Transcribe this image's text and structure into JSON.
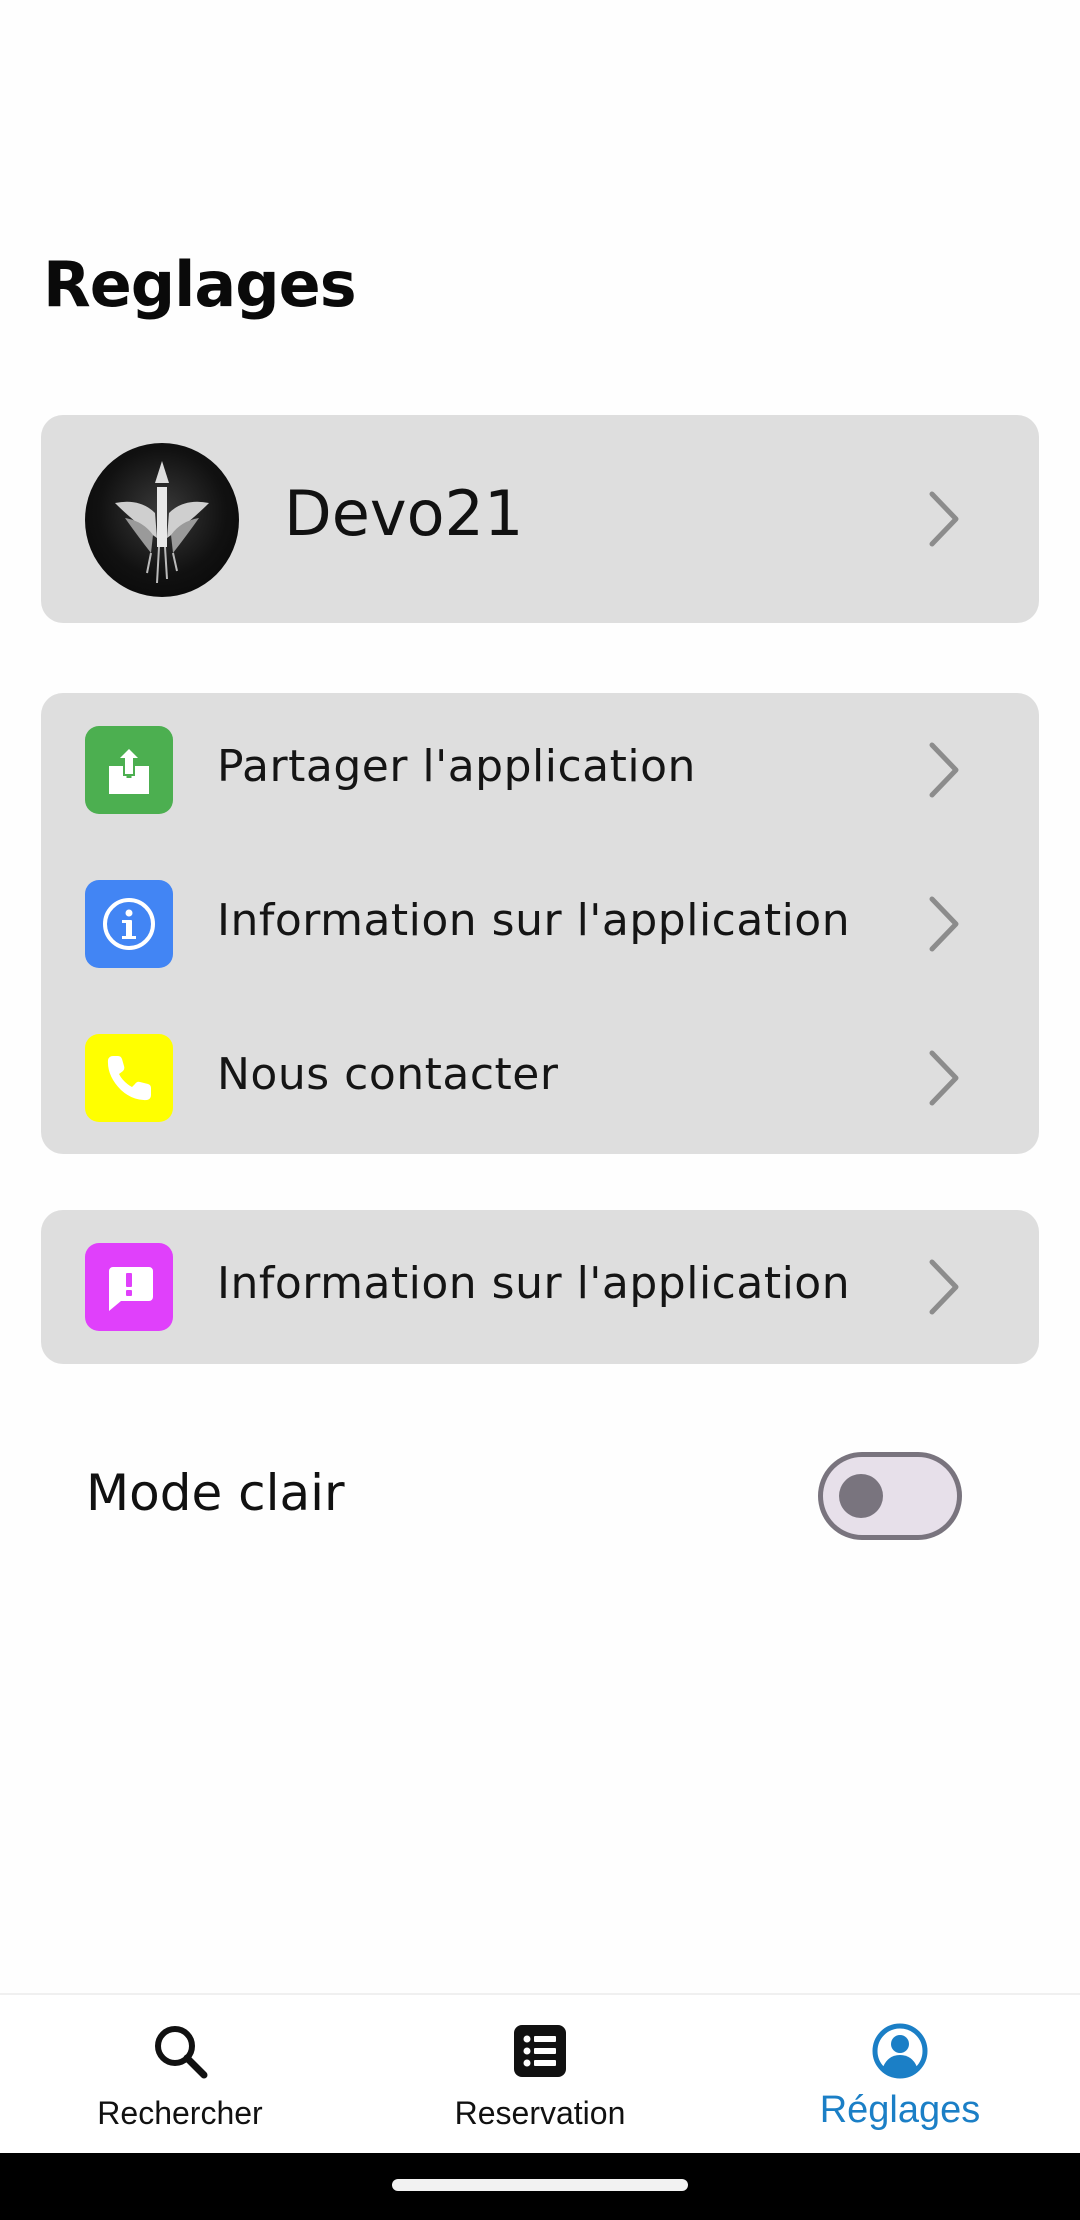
{
  "page": {
    "title": "Reglages"
  },
  "profile": {
    "name": "Devo21"
  },
  "menu": {
    "items": [
      {
        "label": "Partager l'application",
        "icon": "share-icon",
        "color": "#4caf50"
      },
      {
        "label": "Information sur l'application",
        "icon": "info-icon",
        "color": "#4285f4"
      },
      {
        "label": "Nous contacter",
        "icon": "phone-icon",
        "color": "#ffff00"
      }
    ]
  },
  "info": {
    "label": "Information sur l'application",
    "icon": "report-icon",
    "color": "#e040fb"
  },
  "mode": {
    "label": "Mode clair",
    "enabled": false
  },
  "nav": {
    "items": [
      {
        "label": "Rechercher",
        "icon": "search-icon"
      },
      {
        "label": "Reservation",
        "icon": "list-icon"
      },
      {
        "label": "Réglages",
        "icon": "account-icon",
        "active": true
      }
    ],
    "accent": "#1b7fc6"
  }
}
